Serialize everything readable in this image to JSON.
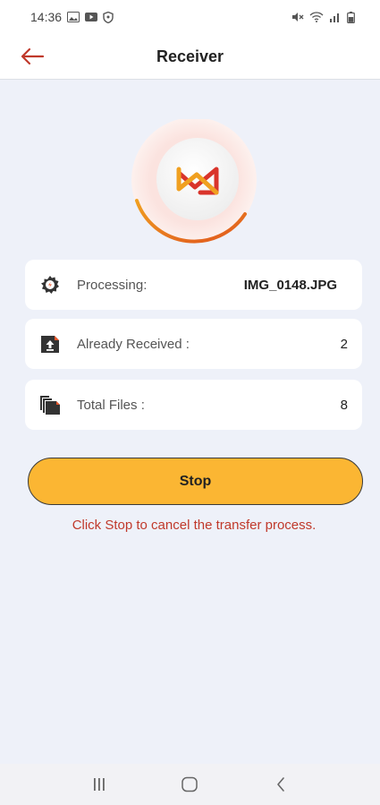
{
  "status_bar": {
    "time": "14:36"
  },
  "app_bar": {
    "title": "Receiver"
  },
  "rows": {
    "processing": {
      "label": "Processing:",
      "value": "IMG_0148.JPG"
    },
    "received": {
      "label": "Already Received :",
      "value": "2"
    },
    "total": {
      "label": "Total Files :",
      "value": "8"
    }
  },
  "stop_button": {
    "label": "Stop"
  },
  "hint": "Click Stop to cancel the transfer process.",
  "colors": {
    "accent": "#fbb633",
    "back_arrow": "#c0392b",
    "hint": "#c0392b",
    "logo_red": "#d9342b",
    "logo_orange": "#f0a020"
  },
  "icons": [
    "back-arrow-icon",
    "gear-icon",
    "upload-icon",
    "files-icon",
    "logo-icon",
    "recents-icon",
    "home-icon",
    "back-icon"
  ]
}
